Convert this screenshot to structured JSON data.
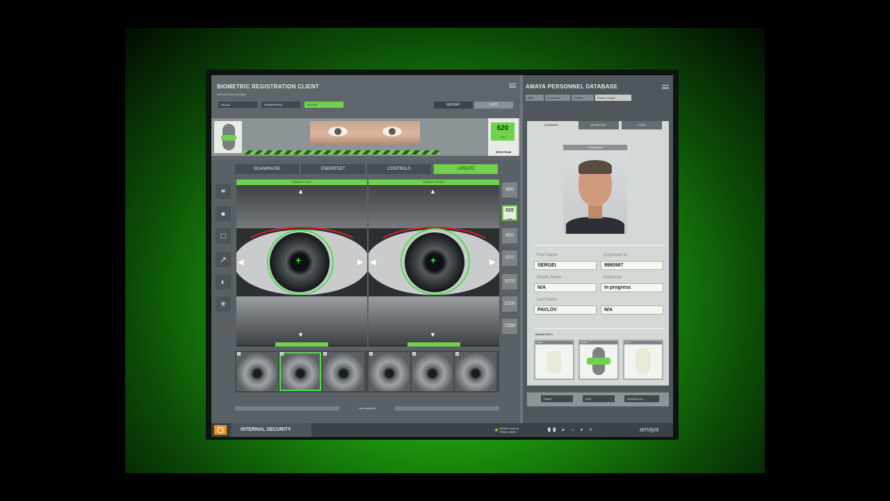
{
  "left_app": {
    "title": "BIOMETRIC REGISTRATION CLIENT",
    "subtitle": "Selected biometric type",
    "types": [
      {
        "label": "FACIAL"
      },
      {
        "label": "FINGERPRINT"
      },
      {
        "label": "RETINA",
        "active": true
      }
    ],
    "repeat_label": "REPEAT",
    "exit_label": "EXIT",
    "wavelength": {
      "value": "620",
      "unit": "nm",
      "caption": "SPECTRUM"
    },
    "tabs": [
      {
        "label": "SCAN/PAUSE"
      },
      {
        "label": "END/RESET"
      },
      {
        "label": "CONTROLS"
      },
      {
        "label": "UPDATE",
        "active": true
      }
    ],
    "eye_left_label": "SUBJECT LEFT",
    "eye_right_label": "SUBJECT RIGHT",
    "wavelengths": [
      {
        "label": "400"
      },
      {
        "label": "620",
        "unit": "nm",
        "active": true
      },
      {
        "label": "800"
      },
      {
        "label": "970"
      },
      {
        "label": "1070"
      },
      {
        "label": "1200"
      },
      {
        "label": "1550"
      }
    ],
    "thumb_numbers": [
      "1",
      "2",
      "3",
      "4",
      "5",
      "6"
    ],
    "live_captures_label": "Live captures"
  },
  "right_app": {
    "title": "AMAYA PERSONNEL DATABASE",
    "breadcrumbs": [
      "Main",
      "Personnel",
      "Profiles",
      "Pavlov, Sergei"
    ],
    "tabs": [
      {
        "label": "SUMMARY",
        "active": true
      },
      {
        "label": "BIOMETRIC"
      },
      {
        "label": "CARD"
      }
    ],
    "photo_label": "Photograph",
    "fields": {
      "first_name_label": "First Name",
      "first_name": "SERGEI",
      "employee_id_label": "Employee ID",
      "employee_id": "9980987",
      "middle_name_label": "Middle Name",
      "middle_name": "N/A",
      "extension_label": "Extension",
      "extension": "In progress",
      "last_name_label": "Last Name",
      "last_name": "PAVLOV",
      "last_extra": "N/A"
    },
    "biometrics_label": "BIOMETRICS",
    "biometric_boxes": [
      "Finger",
      "Retina",
      "Face"
    ],
    "buttons": [
      "PRINT",
      "EDIT",
      "UPDATE ALL"
    ]
  },
  "taskbar": {
    "section_label": "INTERNAL SECURITY",
    "status_line1": "System running",
    "status_line2": "Version Alpha",
    "brand": "amaya"
  },
  "colors": {
    "accent": "#6fd14c",
    "ring": "#4ee04a",
    "warning": "#e02020",
    "orange": "#e7952c"
  }
}
